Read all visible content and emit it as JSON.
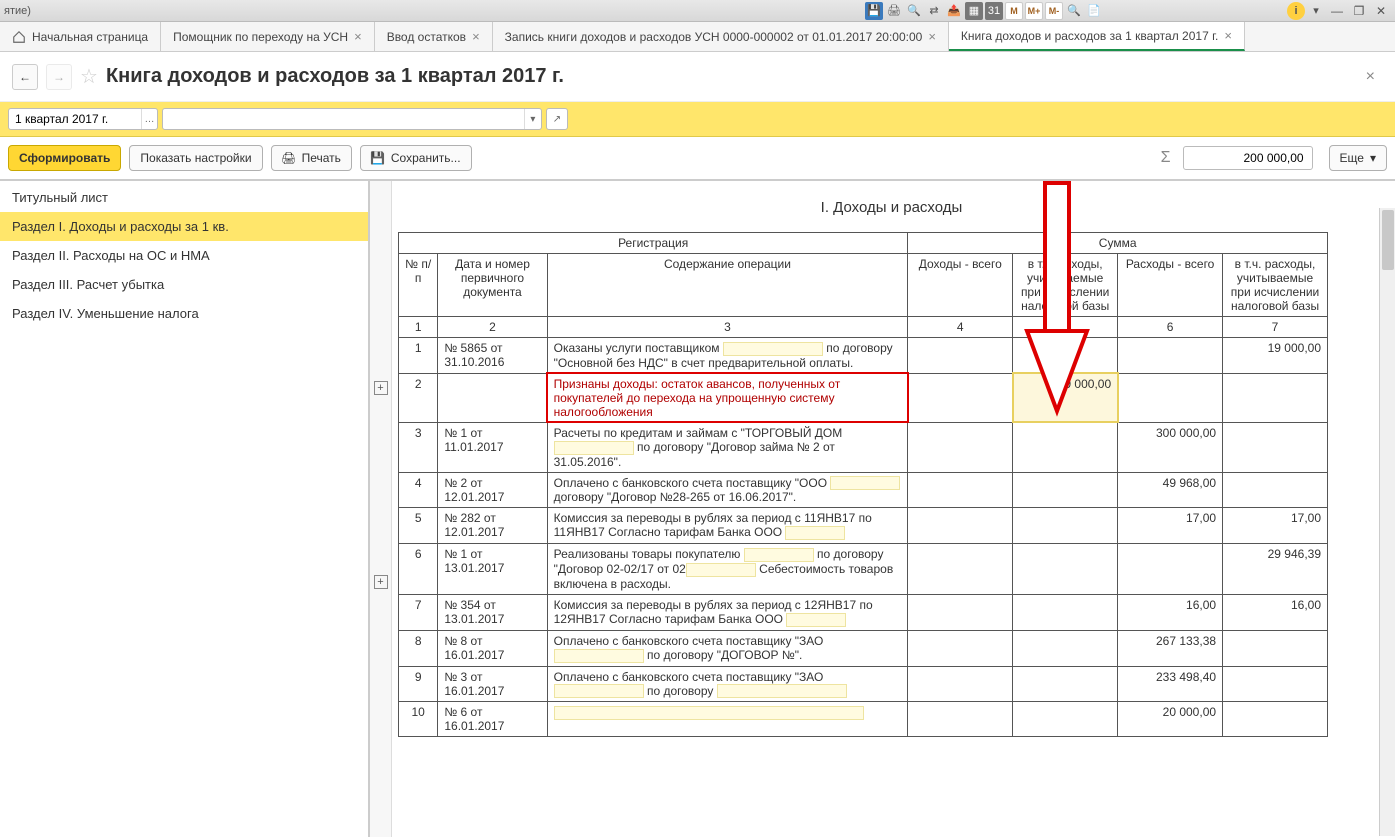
{
  "window": {
    "title_fragment": "ятие)"
  },
  "toolbar_icons": {
    "m": "M",
    "mplus": "M+",
    "mminus": "M-"
  },
  "tabs": [
    {
      "label": "Начальная страница",
      "closable": false
    },
    {
      "label": "Помощник по переходу на УСН",
      "closable": true
    },
    {
      "label": "Ввод остатков",
      "closable": true
    },
    {
      "label": "Запись книги доходов и расходов УСН 0000-000002 от 01.01.2017 20:00:00",
      "closable": true
    },
    {
      "label": "Книга доходов и расходов за 1 квартал 2017 г.",
      "closable": true
    }
  ],
  "page": {
    "title": "Книга доходов и расходов за 1 квартал 2017 г.",
    "period_label": "1 квартал 2017 г."
  },
  "actions": {
    "generate": "Сформировать",
    "show_settings": "Показать настройки",
    "print": "Печать",
    "save": "Сохранить...",
    "more": "Еще"
  },
  "sum_total": "200 000,00",
  "sidebar": {
    "items": [
      {
        "label": "Титульный лист"
      },
      {
        "label": "Раздел I. Доходы и расходы за 1 кв."
      },
      {
        "label": "Раздел II. Расходы на ОС и НМА"
      },
      {
        "label": "Раздел III. Расчет убытка"
      },
      {
        "label": "Раздел IV. Уменьшение налога"
      }
    ],
    "active_index": 1
  },
  "report": {
    "section_title": "I. Доходы и расходы",
    "headers": {
      "registration": "Регистрация",
      "amount": "Сумма",
      "no": "№ п/п",
      "docdate": "Дата и номер первичного документа",
      "desc": "Содержание операции",
      "income_total": "Доходы - всего",
      "income_tax": "в т.ч. доходы, учитываемые при исчислении налоговой базы",
      "expense_total": "Расходы - всего",
      "expense_tax": "в т.ч. расходы, учитываемые при исчислении налоговой базы"
    },
    "col_nums": {
      "c1": "1",
      "c2": "2",
      "c3": "3",
      "c4": "4",
      "c5": "5",
      "c6": "6",
      "c7": "7"
    },
    "rows": [
      {
        "n": "1",
        "doc": "№ 5865 от 31.10.2016",
        "desc_a": "Оказаны услуги поставщиком ",
        "desc_b": " по договору \"Основной без НДС\" в счет предварительной оплаты.",
        "mask_a": 100,
        "inc_tax": "",
        "exp_tot": "",
        "exp_tax": "19 000,00"
      },
      {
        "n": "2",
        "doc": "",
        "desc_a": "Признаны доходы: остаток авансов, полученных от покупателей до перехода на упрощенную систему налогообложения",
        "highlight": true,
        "inc_tax": "200 000,00",
        "exp_tot": "",
        "exp_tax": ""
      },
      {
        "n": "3",
        "doc": "№ 1 от 11.01.2017",
        "desc_a": "Расчеты по кредитам и займам с \"ТОРГОВЫЙ ДОМ ",
        "desc_b": " по договору \"Договор займа № 2 от 31.05.2016\".",
        "mask_a": 80,
        "exp_tot": "300 000,00",
        "exp_tax": ""
      },
      {
        "n": "4",
        "doc": "№ 2 от 12.01.2017",
        "desc_a": "Оплачено с банковского счета поставщику \"ООО ",
        "desc_b": " договору \"Договор №28-265 от 16.06.2017\".",
        "mask_a": 70,
        "exp_tot": "49 968,00",
        "exp_tax": ""
      },
      {
        "n": "5",
        "doc": "№ 282 от 12.01.2017",
        "desc_a": "Комиссия за переводы в рублях за период с 11ЯНВ17 по 11ЯНВ17 Согласно тарифам Банка ООО ",
        "mask_a": 60,
        "exp_tot": "17,00",
        "exp_tax": "17,00"
      },
      {
        "n": "6",
        "doc": "№ 1 от 13.01.2017",
        "desc_a": "Реализованы товары покупателю ",
        "desc_b": " по договору \"Договор 02-02/17 от 02",
        "desc_c": " Себестоимость товаров включена в расходы.",
        "mask_a": 70,
        "mask_b": 70,
        "exp_tot": "",
        "exp_tax": "29 946,39"
      },
      {
        "n": "7",
        "doc": "№ 354 от 13.01.2017",
        "desc_a": "Комиссия за переводы в рублях за период с 12ЯНВ17 по 12ЯНВ17 Согласно тарифам Банка ООО ",
        "mask_a": 60,
        "exp_tot": "16,00",
        "exp_tax": "16,00"
      },
      {
        "n": "8",
        "doc": "№ 8 от 16.01.2017",
        "desc_a": "Оплачено с банковского счета поставщику \"ЗАО ",
        "desc_b": " по договору \"ДОГОВОР №\".",
        "mask_a": 90,
        "exp_tot": "267 133,38",
        "exp_tax": ""
      },
      {
        "n": "9",
        "doc": "№ 3 от 16.01.2017",
        "desc_a": "Оплачено с банковского счета поставщику \"ЗАО ",
        "desc_b": " по договору ",
        "mask_a": 90,
        "mask_b": 130,
        "exp_tot": "233 498,40",
        "exp_tax": ""
      },
      {
        "n": "10",
        "doc": "№ 6 от 16.01.2017",
        "desc_a": "",
        "mask_a": 310,
        "exp_tot": "20 000,00",
        "exp_tax": ""
      }
    ]
  }
}
